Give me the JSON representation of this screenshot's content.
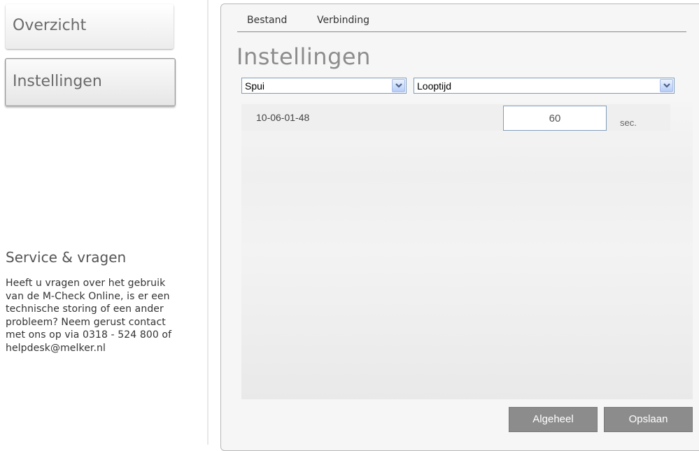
{
  "sidebar": {
    "items": [
      {
        "label": "Overzicht"
      },
      {
        "label": "Instellingen"
      }
    ],
    "service": {
      "title": "Service & vragen",
      "text": "Heeft u vragen over het gebruik van de M-Check Online, is er een technische storing of een ander probleem? Neem gerust contact met ons op via 0318 - 524 800 of helpdesk@melker.nl"
    }
  },
  "menu": {
    "items": [
      {
        "label": "Bestand"
      },
      {
        "label": "Verbinding"
      }
    ]
  },
  "main": {
    "title": "Instellingen",
    "location_select": {
      "value": "Spui",
      "icon": "chevron-down-icon"
    },
    "type_select": {
      "value": "Looptijd",
      "icon": "chevron-down-icon"
    },
    "rows": [
      {
        "id": "10-06-01-48",
        "value": "60",
        "unit": "sec."
      }
    ]
  },
  "buttons": {
    "algeheel": "Algeheel",
    "opslaan": "Opslaan"
  },
  "colors": {
    "button_bg": "#8c8c8c",
    "title_text": "#8c8c8c",
    "input_border": "#7f9db9"
  }
}
